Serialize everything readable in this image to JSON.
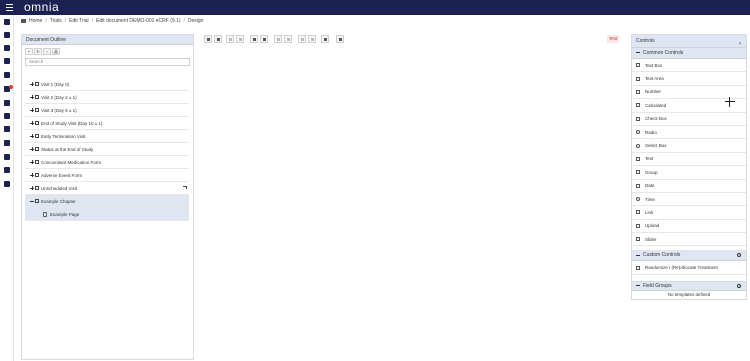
{
  "app": {
    "logo": "omnia"
  },
  "breadcrumb": {
    "home": "Home",
    "trials": "Trials",
    "edit_trial": "Edit Trial",
    "edit_document": "Edit document DEMO-001 eCRF (9.1)",
    "design": "Design"
  },
  "outline": {
    "title": "Document Outline",
    "search_placeholder": "Search",
    "items": [
      {
        "label": "Visit 1 (Day 0)"
      },
      {
        "label": "Visit 2 (Day 2 ± 1)"
      },
      {
        "label": "Visit 3 (Day 5 ± 1)"
      },
      {
        "label": "End of Study Visit (Day 10 ± 1)"
      },
      {
        "label": "Early Termination Visit"
      },
      {
        "label": "Status at the End of Study"
      },
      {
        "label": "Concomitant Medication Form"
      },
      {
        "label": "Adverse Event Form"
      },
      {
        "label": "Unscheduled Visit"
      },
      {
        "label": "Example Chapter"
      },
      {
        "label": "Example Page"
      }
    ]
  },
  "editor": {
    "badge": "Test"
  },
  "controls": {
    "title": "Controls",
    "common_title": "Common Controls",
    "common": [
      {
        "label": "Text Box",
        "icon": "textbox-icon"
      },
      {
        "label": "Text Area",
        "icon": "textarea-icon"
      },
      {
        "label": "Number",
        "icon": "number-icon"
      },
      {
        "label": "Calculated",
        "icon": "calculator-icon"
      },
      {
        "label": "Check Box",
        "icon": "checkbox-icon"
      },
      {
        "label": "Radio",
        "icon": "radio-icon"
      },
      {
        "label": "Select Box",
        "icon": "select-icon"
      },
      {
        "label": "Text",
        "icon": "text-icon"
      },
      {
        "label": "Group",
        "icon": "group-icon"
      },
      {
        "label": "Date",
        "icon": "calendar-icon"
      },
      {
        "label": "Time",
        "icon": "clock-icon"
      },
      {
        "label": "Link",
        "icon": "link-icon"
      },
      {
        "label": "Upload",
        "icon": "upload-icon"
      },
      {
        "label": "Slider",
        "icon": "slider-icon"
      }
    ],
    "custom_title": "Custom Controls",
    "custom": [
      {
        "label": "Randomize / (Re)Allocate Treatment",
        "icon": "shuffle-icon"
      }
    ],
    "field_groups_title": "Field Groups",
    "no_templates": "No templates defined"
  }
}
